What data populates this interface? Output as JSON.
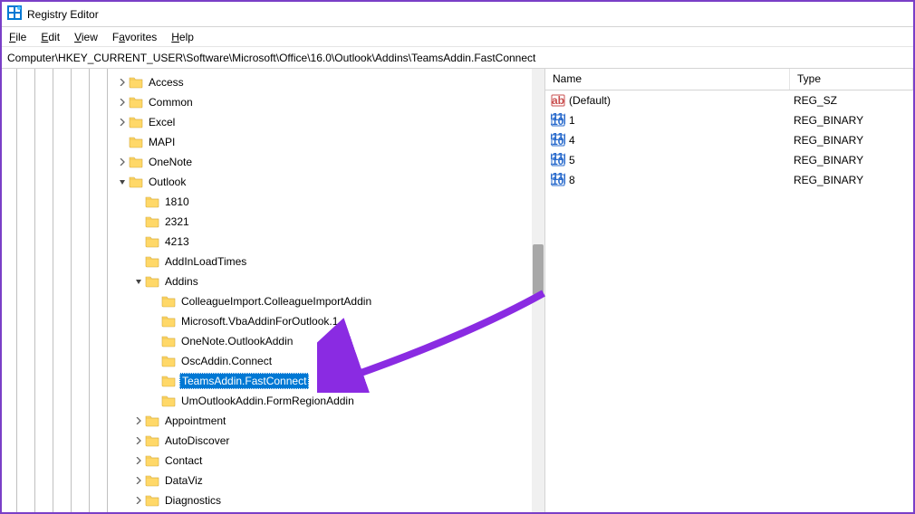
{
  "app": {
    "title": "Registry Editor"
  },
  "menu": {
    "file": "File",
    "edit": "Edit",
    "view": "View",
    "favorites": "Favorites",
    "help": "Help"
  },
  "address": "Computer\\HKEY_CURRENT_USER\\Software\\Microsoft\\Office\\16.0\\Outlook\\Addins\\TeamsAddin.FastConnect",
  "tree": [
    {
      "indent": 7,
      "caret": ">",
      "label": "Access"
    },
    {
      "indent": 7,
      "caret": ">",
      "label": "Common"
    },
    {
      "indent": 7,
      "caret": ">",
      "label": "Excel"
    },
    {
      "indent": 7,
      "caret": "",
      "label": "MAPI"
    },
    {
      "indent": 7,
      "caret": ">",
      "label": "OneNote"
    },
    {
      "indent": 7,
      "caret": "v",
      "label": "Outlook"
    },
    {
      "indent": 8,
      "caret": "",
      "label": "1810"
    },
    {
      "indent": 8,
      "caret": "",
      "label": "2321"
    },
    {
      "indent": 8,
      "caret": "",
      "label": "4213"
    },
    {
      "indent": 8,
      "caret": "",
      "label": "AddInLoadTimes"
    },
    {
      "indent": 8,
      "caret": "v",
      "label": "Addins"
    },
    {
      "indent": 9,
      "caret": "",
      "label": "ColleagueImport.ColleagueImportAddin"
    },
    {
      "indent": 9,
      "caret": "",
      "label": "Microsoft.VbaAddinForOutlook.1"
    },
    {
      "indent": 9,
      "caret": "",
      "label": "OneNote.OutlookAddin"
    },
    {
      "indent": 9,
      "caret": "",
      "label": "OscAddin.Connect"
    },
    {
      "indent": 9,
      "caret": "",
      "label": "TeamsAddin.FastConnect",
      "selected": true
    },
    {
      "indent": 9,
      "caret": "",
      "label": "UmOutlookAddin.FormRegionAddin"
    },
    {
      "indent": 8,
      "caret": ">",
      "label": "Appointment"
    },
    {
      "indent": 8,
      "caret": ">",
      "label": "AutoDiscover"
    },
    {
      "indent": 8,
      "caret": ">",
      "label": "Contact"
    },
    {
      "indent": 8,
      "caret": ">",
      "label": "DataViz"
    },
    {
      "indent": 8,
      "caret": ">",
      "label": "Diagnostics"
    }
  ],
  "columns": {
    "name": "Name",
    "type": "Type"
  },
  "values": [
    {
      "icon": "string",
      "name": "(Default)",
      "type": "REG_SZ"
    },
    {
      "icon": "binary",
      "name": "1",
      "type": "REG_BINARY"
    },
    {
      "icon": "binary",
      "name": "4",
      "type": "REG_BINARY"
    },
    {
      "icon": "binary",
      "name": "5",
      "type": "REG_BINARY"
    },
    {
      "icon": "binary",
      "name": "8",
      "type": "REG_BINARY"
    }
  ]
}
